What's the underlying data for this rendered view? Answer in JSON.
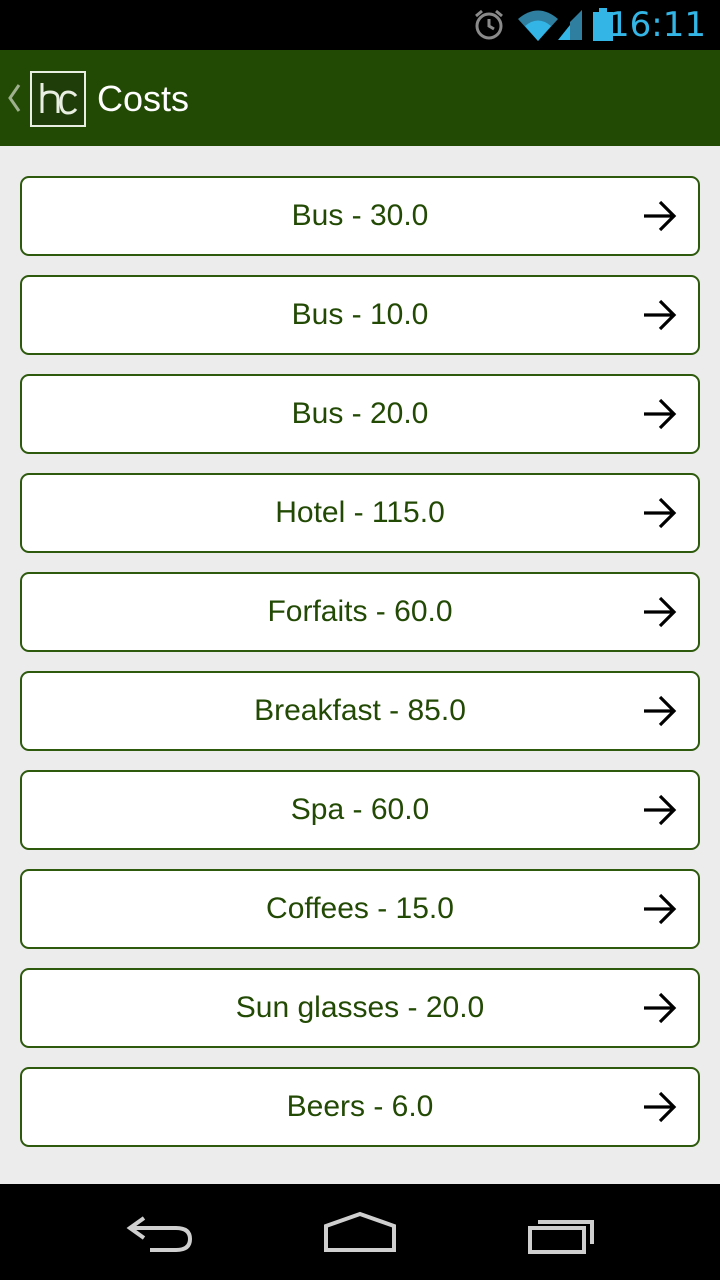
{
  "status_bar": {
    "time": "16:11",
    "icons": [
      "alarm-icon",
      "wifi-icon",
      "signal-icon",
      "battery-icon"
    ]
  },
  "action_bar": {
    "title": "Costs",
    "logo_text": "hc",
    "up_icon": "chevron-left-icon"
  },
  "costs": [
    {
      "label": "Bus - 30.0"
    },
    {
      "label": "Bus - 10.0"
    },
    {
      "label": "Bus - 20.0"
    },
    {
      "label": "Hotel - 115.0"
    },
    {
      "label": "Forfaits - 60.0"
    },
    {
      "label": "Breakfast - 85.0"
    },
    {
      "label": "Spa - 60.0"
    },
    {
      "label": "Coffees - 15.0"
    },
    {
      "label": "Sun glasses - 20.0"
    },
    {
      "label": "Beers - 6.0"
    }
  ],
  "nav_bar": {
    "icons": [
      "back-icon",
      "home-icon",
      "recent-apps-icon"
    ]
  },
  "colors": {
    "action_bar": "#234a05",
    "item_text": "#234a05",
    "item_border": "#2e5a0e",
    "status_accent": "#33b5e5",
    "background": "#ececec"
  }
}
